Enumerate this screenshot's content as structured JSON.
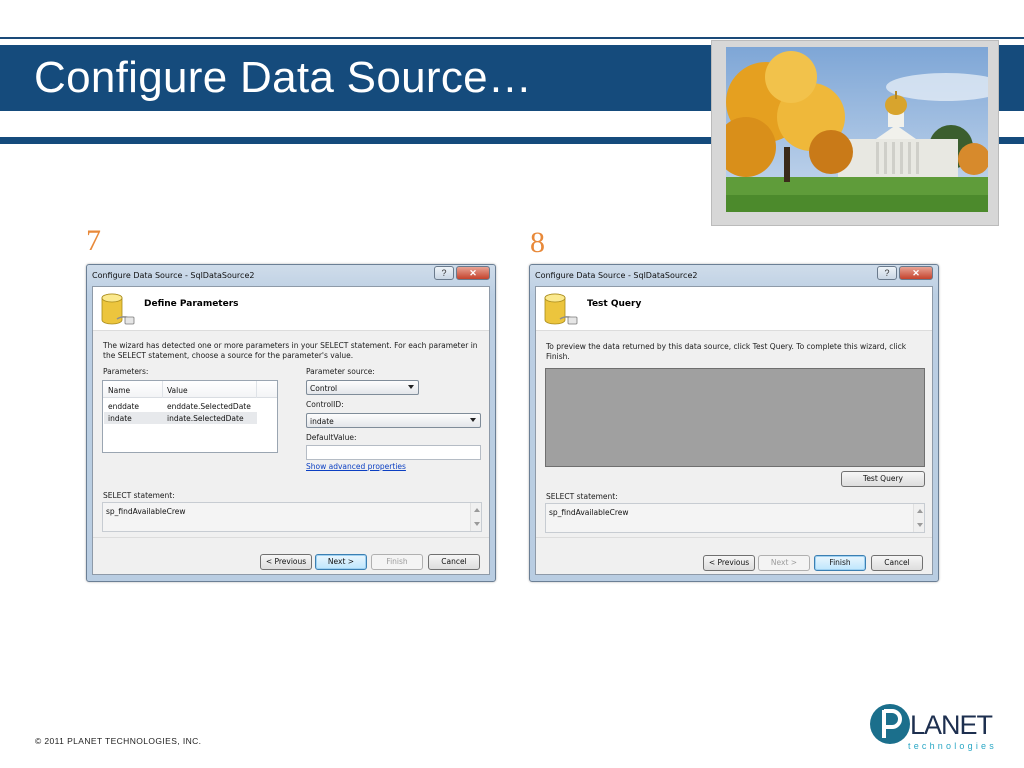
{
  "slide": {
    "title": "Configure Data Source…",
    "copyright": "© 2011  PLANET  TECHNOLOGIES,  INC."
  },
  "logo": {
    "word": "LANET",
    "tagline": "technologies"
  },
  "steps": [
    {
      "number": "7",
      "window_title": "Configure Data Source - SqlDataSource2",
      "help_glyph": "?",
      "close_glyph": "✕",
      "header": "Define Parameters",
      "description": "The wizard has detected one or more parameters in your SELECT statement. For each parameter in the SELECT statement, choose a source for the parameter's value.",
      "parameters_label": "Parameters:",
      "columns": [
        "Name",
        "Value"
      ],
      "rows": [
        {
          "name": "enddate",
          "value": "enddate.SelectedDate"
        },
        {
          "name": "indate",
          "value": "indate.SelectedDate"
        }
      ],
      "parameter_source_label": "Parameter source:",
      "parameter_source_value": "Control",
      "control_id_label": "ControlID:",
      "control_id_value": "indate",
      "default_value_label": "DefaultValue:",
      "default_value": "",
      "advanced_link": "Show advanced properties",
      "select_label": "SELECT statement:",
      "select_value": "sp_findAvailableCrew",
      "buttons": {
        "previous": "< Previous",
        "next": "Next >",
        "finish": "Finish",
        "cancel": "Cancel"
      }
    },
    {
      "number": "8",
      "window_title": "Configure Data Source - SqlDataSource2",
      "help_glyph": "?",
      "close_glyph": "✕",
      "header": "Test Query",
      "description": "To preview the data returned by this data source, click Test Query. To complete this wizard, click Finish.",
      "test_query_button": "Test Query",
      "select_label": "SELECT statement:",
      "select_value": "sp_findAvailableCrew",
      "buttons": {
        "previous": "< Previous",
        "next": "Next >",
        "finish": "Finish",
        "cancel": "Cancel"
      }
    }
  ],
  "colors": {
    "title_band": "#154b7c",
    "step_number": "#e8893a",
    "link": "#0b3fc2"
  },
  "icons": [
    "database-icon",
    "help-icon",
    "close-icon",
    "dropdown-arrow-icon",
    "planet-logo-icon",
    "landscape-photo"
  ]
}
